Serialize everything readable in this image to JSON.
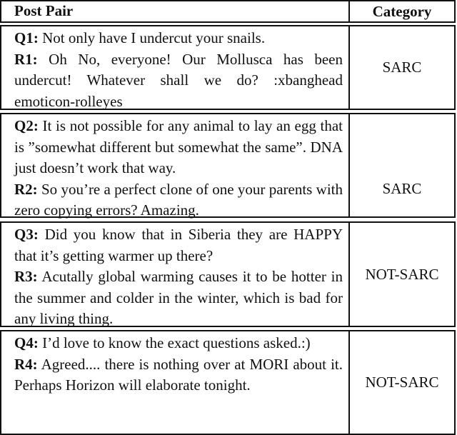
{
  "header": {
    "post_pair": "Post Pair",
    "category": "Category"
  },
  "rows": [
    {
      "q_label": "Q1:",
      "q_text": "Not only have I undercut your snails.",
      "r_label": "R1:",
      "r_text": "Oh No, everyone! Our Mollusca has been undercut! Whatever shall we do? :xbanghead emoticon-rolleyes",
      "category": "SARC"
    },
    {
      "q_label": "Q2:",
      "q_text": "It is not possible for any animal to lay an egg that is ”somewhat different but somewhat the same”. DNA just doesn’t work that way.",
      "r_label": "R2:",
      "r_text": "So you’re a perfect clone of one your parents with zero copying errors? Amazing.",
      "category": "SARC"
    },
    {
      "q_label": "Q3:",
      "q_text": "Did you know that in Siberia they are HAPPY that it’s getting warmer up there?",
      "r_label": "R3:",
      "r_text": "Acutally global warming causes it to be hotter in the summer and colder in the winter, which is bad for any living thing.",
      "category": "NOT-SARC"
    },
    {
      "q_label": "Q4:",
      "q_text": "I’d love to know the exact questions asked.:)",
      "r_label": "R4:",
      "r_text": "Agreed.... there is nothing over at MORI about it. Perhaps Horizon will elaborate tonight.",
      "category": "NOT-SARC"
    }
  ]
}
